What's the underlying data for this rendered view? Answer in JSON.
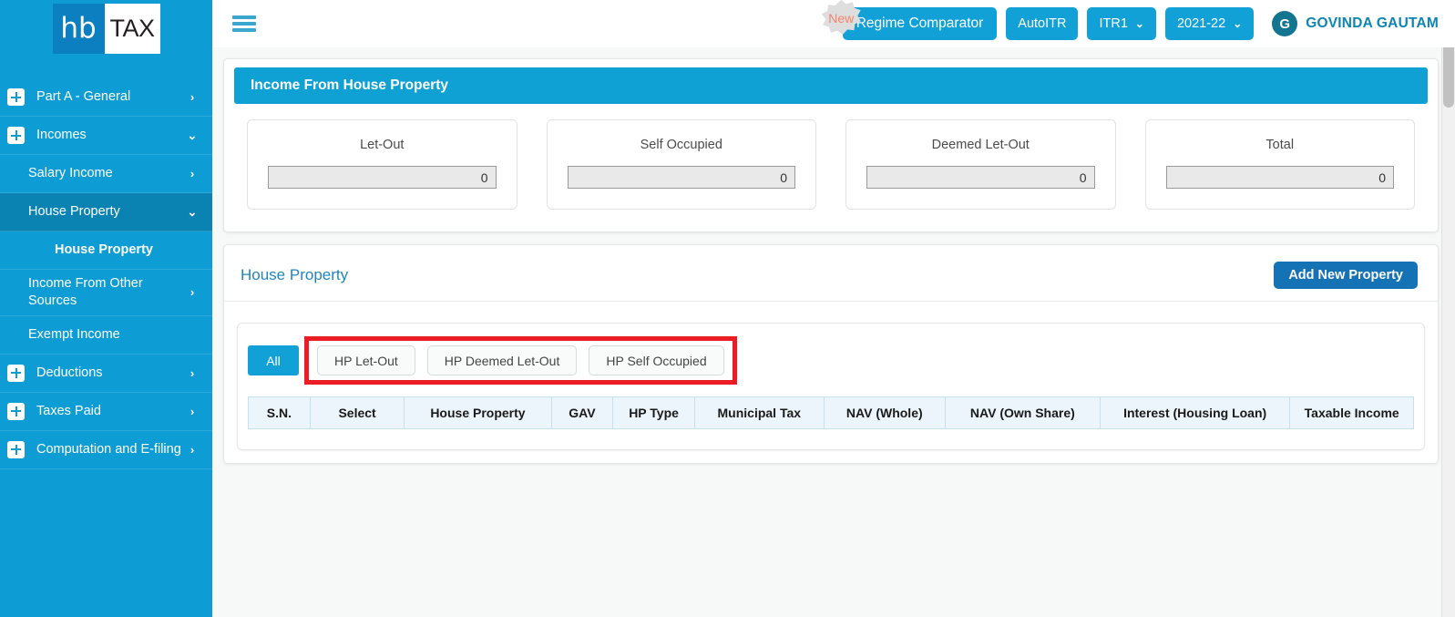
{
  "brand": {
    "logo_hb": "hb",
    "logo_tax": "TAX"
  },
  "sidebar": {
    "items": [
      {
        "label": "Part A - General",
        "icon": "plus-icon",
        "chevron": "›",
        "level": 1,
        "state": "collapsed"
      },
      {
        "label": "Incomes",
        "icon": "plus-icon",
        "chevron": "⌄",
        "level": 1,
        "state": "expanded"
      },
      {
        "label": "Salary Income",
        "chevron": "›",
        "level": 2,
        "state": "collapsed"
      },
      {
        "label": "House Property",
        "chevron": "⌄",
        "level": 2,
        "state": "active-expanded"
      },
      {
        "label": "House Property",
        "chevron": "",
        "level": 3,
        "state": "selected"
      },
      {
        "label": "Income From Other Sources",
        "chevron": "›",
        "level": 2,
        "state": "collapsed"
      },
      {
        "label": "Exempt Income",
        "chevron": "",
        "level": 2,
        "state": "collapsed"
      },
      {
        "label": "Deductions",
        "icon": "plus-icon",
        "chevron": "›",
        "level": 1,
        "state": "collapsed"
      },
      {
        "label": "Taxes Paid",
        "icon": "plus-icon",
        "chevron": "›",
        "level": 1,
        "state": "collapsed"
      },
      {
        "label": "Computation and E-filing",
        "icon": "plus-icon",
        "chevron": "›",
        "level": 1,
        "state": "collapsed"
      }
    ]
  },
  "topbar": {
    "menu_icon": "hamburger-icon",
    "new_badge": "New",
    "regime_comparator": "Regime Comparator",
    "auto_itr": "AutoITR",
    "itr_form": "ITR1",
    "assessment_year": "2021-22",
    "caret": "⌄",
    "avatar_initial": "G",
    "user_name": "GOVINDA GAUTAM"
  },
  "summary_panel": {
    "title": "Income From House Property",
    "cards": [
      {
        "label": "Let-Out",
        "value": "0"
      },
      {
        "label": "Self Occupied",
        "value": "0"
      },
      {
        "label": "Deemed Let-Out",
        "value": "0"
      },
      {
        "label": "Total",
        "value": "0"
      }
    ]
  },
  "house_property": {
    "title": "House Property",
    "add_button": "Add New Property",
    "tabs": [
      {
        "label": "All",
        "active": true
      },
      {
        "label": "HP Let-Out",
        "active": false
      },
      {
        "label": "HP Deemed Let-Out",
        "active": false
      },
      {
        "label": "HP Self Occupied",
        "active": false
      }
    ],
    "table_headers": [
      "S.N.",
      "Select",
      "House Property",
      "GAV",
      "HP Type",
      "Municipal Tax",
      "NAV (Whole)",
      "NAV (Own Share)",
      "Interest (Housing Loan)",
      "Taxable Income"
    ],
    "rows": []
  },
  "colors": {
    "sidebar_blue": "#0d9dd4",
    "accent_blue": "#12a1d6",
    "dark_button_blue": "#1573b5",
    "annotation_red": "#ec1c24",
    "avatar_teal": "#13758f",
    "table_header_bg": "#ebf5fb"
  }
}
